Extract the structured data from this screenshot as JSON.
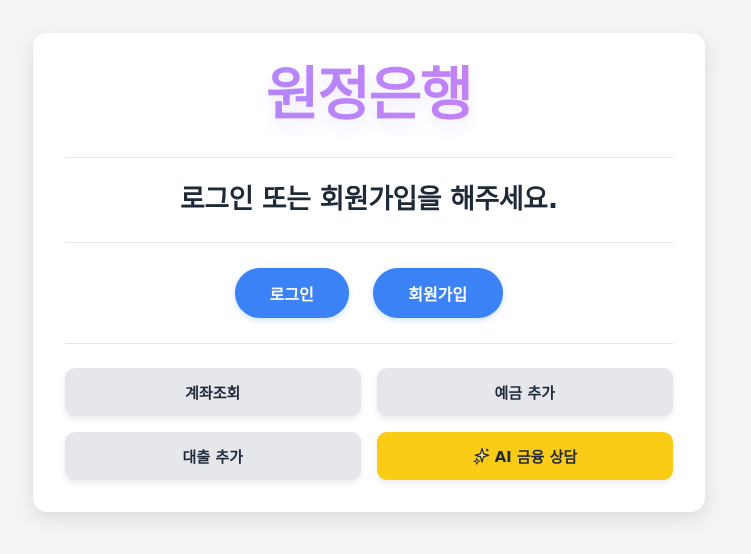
{
  "brand": {
    "title": "원정은행"
  },
  "headline": "로그인 또는 회원가입을 해주세요.",
  "auth": {
    "login_label": "로그인",
    "signup_label": "회원가입"
  },
  "actions": {
    "account_inquiry": "계좌조회",
    "add_deposit": "예금 추가",
    "add_loan": "대출 추가",
    "ai_consult": "AI 금융 상담",
    "ai_icon": "sparkles-icon"
  },
  "colors": {
    "primary": "#3b82f6",
    "ai_accent": "#facc15",
    "tile_bg": "#e5e7eb",
    "brand_gradient_start": "#a78bfa",
    "brand_gradient_end": "#d97ddf"
  }
}
